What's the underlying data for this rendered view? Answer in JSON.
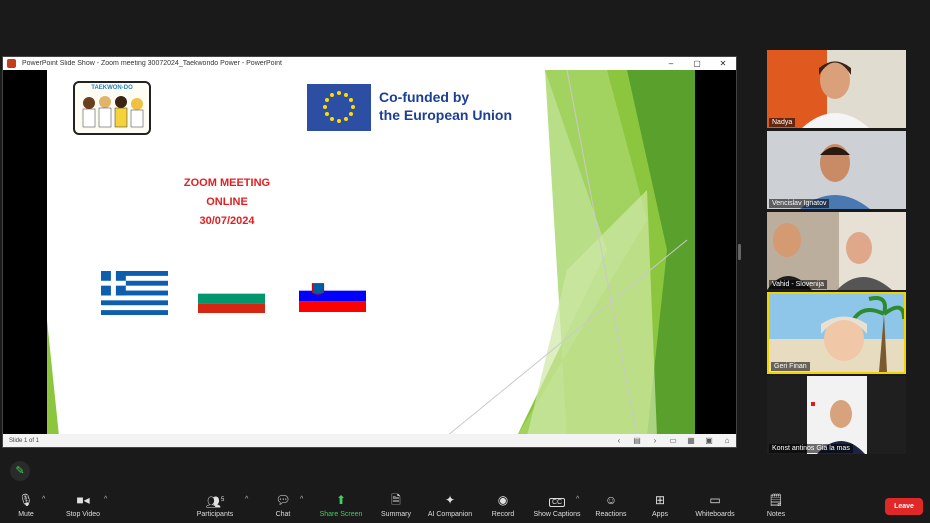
{
  "ppt": {
    "window_title": "PowerPoint Slide Show  -  Zoom meeting 30072024_Taekwondo Power  -  PowerPoint",
    "minimize": "–",
    "maximize": "▢",
    "close": "✕",
    "status": "Slide 1 of 1"
  },
  "slide": {
    "logo_text": "TAEKWON-DO",
    "eu_line1": "Co-funded by",
    "eu_line2": "the European Union",
    "meeting_line1": "ZOOM MEETING",
    "meeting_line2": "ONLINE",
    "meeting_line3": "30/07/2024"
  },
  "participants": [
    {
      "name": "Nadya"
    },
    {
      "name": "Vencislav Ignatov"
    },
    {
      "name": "Vahid - Slovenija"
    },
    {
      "name": "Geri Finan"
    },
    {
      "name": "Konst antinos Gia la mas"
    }
  ],
  "toolbar": {
    "mute": "Mute",
    "stop_video": "Stop Video",
    "participants": "Participants",
    "participants_count": "5",
    "chat": "Chat",
    "share_screen": "Share Screen",
    "summary": "Summary",
    "ai_companion": "AI Companion",
    "record": "Record",
    "show_captions": "Show Captions",
    "cc": "CC",
    "reactions": "Reactions",
    "apps": "Apps",
    "whiteboards": "Whiteboards",
    "notes": "Notes",
    "leave": "Leave"
  },
  "colors": {
    "share_green": "#3fd05a",
    "leave_red": "#e02828",
    "active_speaker": "#f0d400",
    "eu_blue": "#2c4fa3",
    "meeting_red": "#e02020"
  }
}
